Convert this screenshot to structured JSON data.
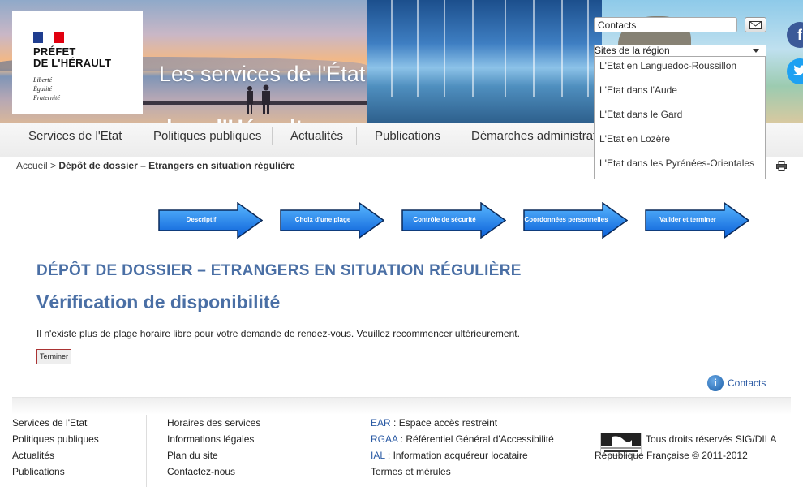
{
  "logo": {
    "title": "PRÉFET\nDE L'HÉRAULT",
    "motto": "Liberté\nÉgalité\nFraternité"
  },
  "site": {
    "title_line1": "Les services de l'État",
    "title_line2": "dans l'Hérault"
  },
  "tools": {
    "contacts_value": "Contacts",
    "mail_icon": "mail-icon",
    "facebook_icon": "facebook-icon",
    "twitter_icon": "twitter-icon"
  },
  "region": {
    "select_label": "Sites de la région",
    "options": [
      "L'Etat en Languedoc-Roussillon",
      "L'Etat dans l'Aude",
      "L'Etat dans le Gard",
      "L'Etat en Lozère",
      "L'Etat dans les Pyrénées-Orientales"
    ]
  },
  "nav": {
    "items": [
      "Services de l'Etat",
      "Politiques publiques",
      "Actualités",
      "Publications",
      "Démarches administrat"
    ]
  },
  "breadcrumb": {
    "home": "Accueil",
    "separator": ">",
    "current": "Dépôt de dossier – Etrangers en situation régulière"
  },
  "steps": [
    "Descriptif",
    "Choix d'une plage",
    "Contrôle de sécurité",
    "Coordonnées personnelles",
    "Valider et terminer"
  ],
  "content": {
    "heading": "DÉPÔT DE DOSSIER – ETRANGERS EN SITUATION RÉGULIÈRE",
    "title": "Vérification de disponibilité",
    "message": "Il n'existe plus de plage horaire libre pour votre demande de rendez-vous. Veuillez recommencer ultérieurement.",
    "finish_label": "Terminer",
    "contacts_label": "Contacts"
  },
  "footer": {
    "col1": [
      "Services de l'Etat",
      "Politiques publiques",
      "Actualités",
      "Publications"
    ],
    "col2": [
      "Horaires des services",
      "Informations légales",
      "Plan du site",
      "Contactez-nous"
    ],
    "col3": [
      {
        "key": "EAR",
        "text": " : Espace accès restreint"
      },
      {
        "key": "RGAA",
        "text": " : Référentiel Général d'Accessibilité"
      },
      {
        "key": "IAL",
        "text": " : Information acquéreur locataire"
      },
      {
        "key": "",
        "text": "Termes et mérules"
      }
    ],
    "legal": "Tous droits réservés SIG/DILA République Française © 2011-2012"
  },
  "colors": {
    "accent": "#4a6fa5",
    "link": "#2a5aa4",
    "step_blue": "#1a73e8"
  }
}
